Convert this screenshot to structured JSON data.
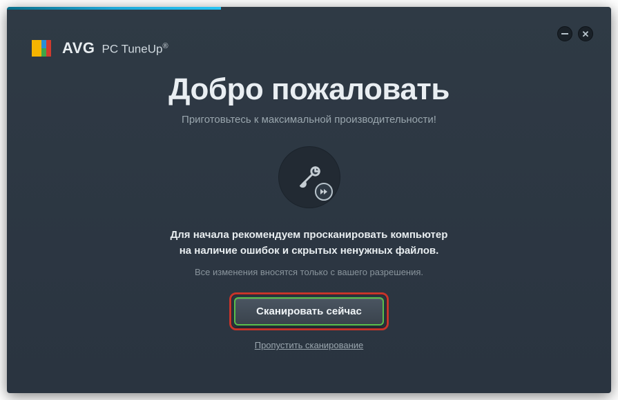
{
  "brand": {
    "name": "AVG",
    "product": "PC TuneUp",
    "registered": "®"
  },
  "welcome": {
    "title": "Добро пожаловать",
    "subtitle": "Приготовьтесь к максимальной производительности!",
    "recommend_line1": "Для начала рекомендуем просканировать компьютер",
    "recommend_line2": "на наличие ошибок и скрытых ненужных файлов.",
    "disclaimer": "Все изменения вносятся только с вашего разрешения.",
    "scan_button": "Сканировать сейчас",
    "skip_link": "Пропустить сканирование"
  },
  "colors": {
    "accent_green": "#5bbf4a",
    "highlight_red": "#c8342a",
    "bg_dark": "#2f3a45",
    "accent_cyan": "#27c4f4"
  }
}
